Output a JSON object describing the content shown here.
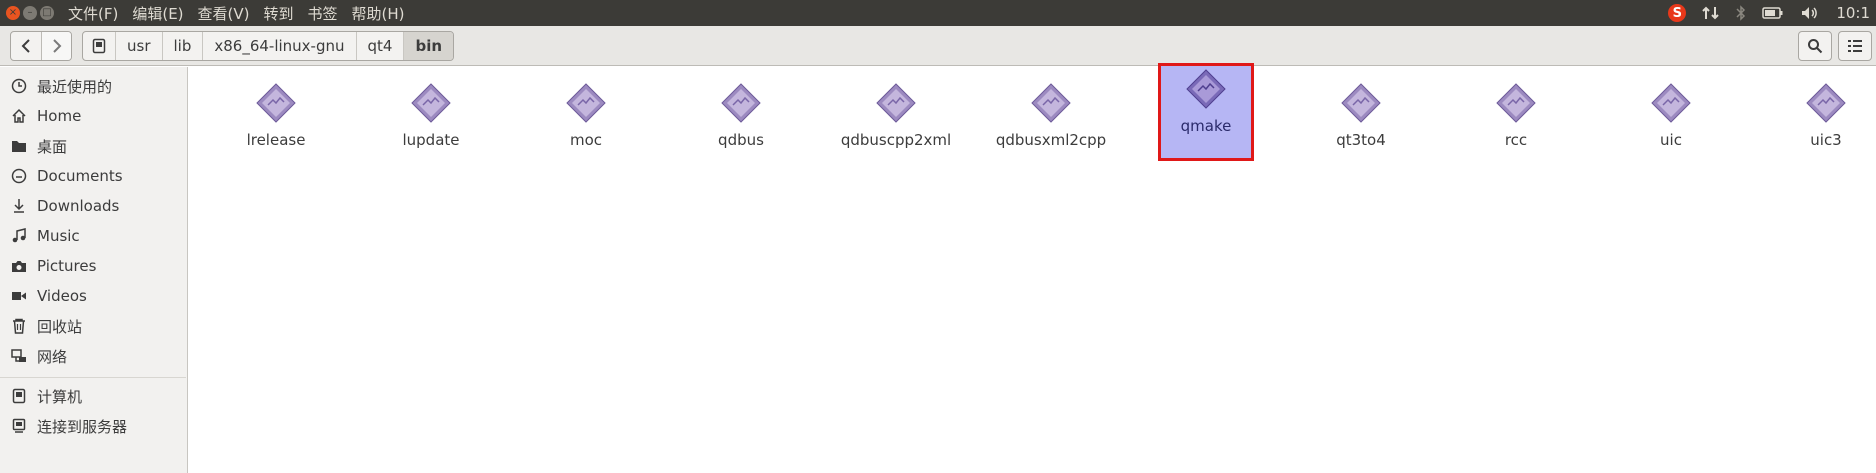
{
  "menubar": {
    "items": [
      "文件(F)",
      "编辑(E)",
      "查看(V)",
      "转到",
      "书签",
      "帮助(H)"
    ],
    "clock": "10:1",
    "input_method": "S"
  },
  "toolbar": {
    "back_icon": "back-arrow-icon",
    "forward_icon": "forward-arrow-icon",
    "breadcrumbs": [
      "usr",
      "lib",
      "x86_64-linux-gnu",
      "qt4",
      "bin"
    ],
    "active_crumb": "bin"
  },
  "sidebar": {
    "places": [
      {
        "label": "最近使用的",
        "icon": "clock-icon"
      },
      {
        "label": "Home",
        "icon": "home-icon"
      },
      {
        "label": "桌面",
        "icon": "folder-icon"
      },
      {
        "label": "Documents",
        "icon": "document-icon"
      },
      {
        "label": "Downloads",
        "icon": "download-icon"
      },
      {
        "label": "Music",
        "icon": "music-icon"
      },
      {
        "label": "Pictures",
        "icon": "camera-icon"
      },
      {
        "label": "Videos",
        "icon": "video-icon"
      },
      {
        "label": "回收站",
        "icon": "trash-icon"
      },
      {
        "label": "网络",
        "icon": "network-icon"
      }
    ],
    "devices": [
      {
        "label": "计算机",
        "icon": "drive-icon"
      },
      {
        "label": "连接到服务器",
        "icon": "server-icon"
      }
    ]
  },
  "files": [
    {
      "name": "lrelease",
      "selected": false
    },
    {
      "name": "lupdate",
      "selected": false
    },
    {
      "name": "moc",
      "selected": false
    },
    {
      "name": "qdbus",
      "selected": false
    },
    {
      "name": "qdbuscpp2xml",
      "selected": false
    },
    {
      "name": "qdbusxml2cpp",
      "selected": false
    },
    {
      "name": "qmake",
      "selected": true
    },
    {
      "name": "qt3to4",
      "selected": false
    },
    {
      "name": "rcc",
      "selected": false
    },
    {
      "name": "uic",
      "selected": false
    },
    {
      "name": "uic3",
      "selected": false
    }
  ],
  "colors": {
    "panel": "#3c3b37",
    "selection": "#b6b6f4",
    "highlight_border": "#e01818",
    "accent": "#e95420"
  }
}
